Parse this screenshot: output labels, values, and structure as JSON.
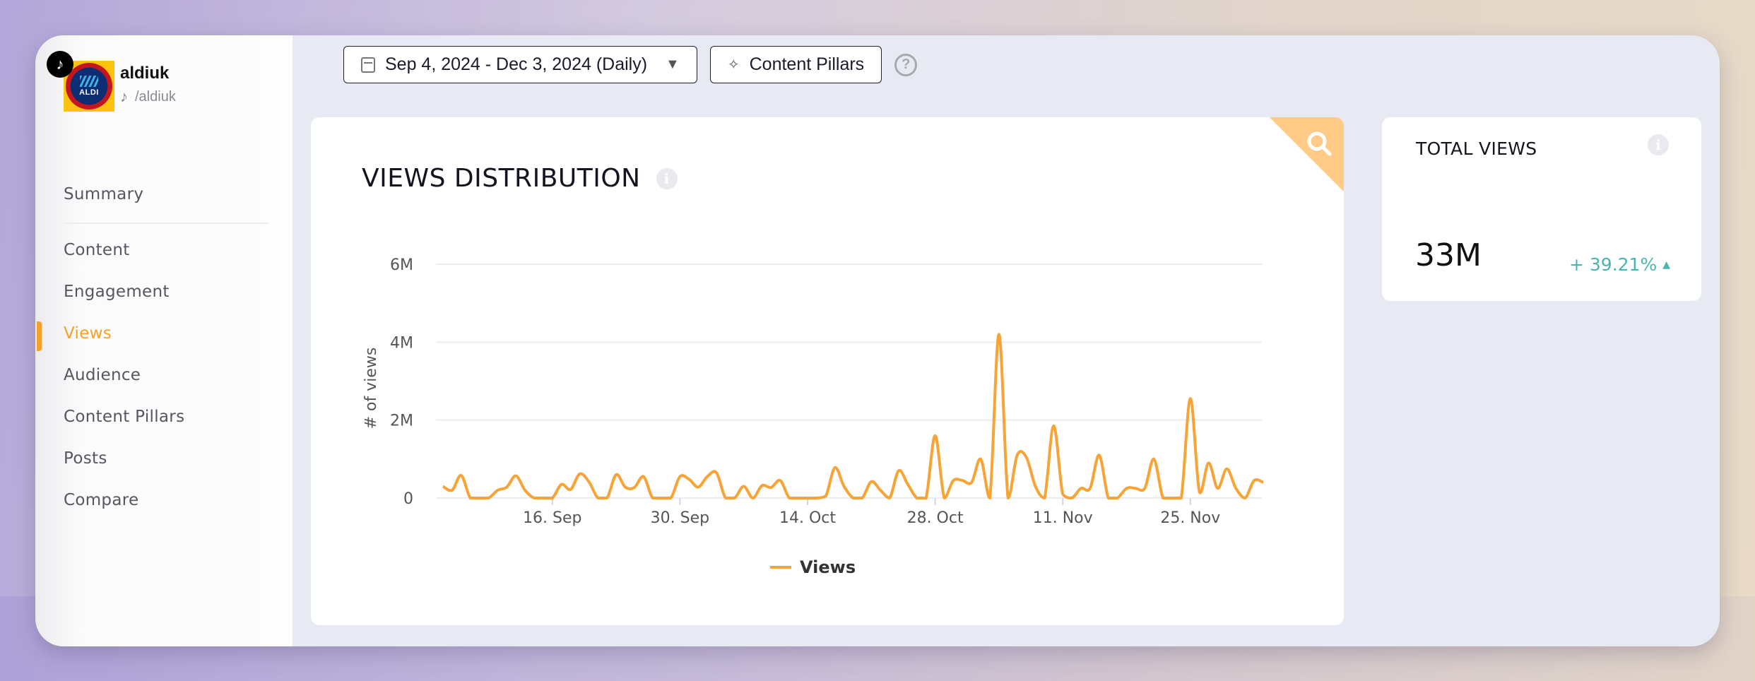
{
  "profile": {
    "name": "aldiuk",
    "handle": "/aldiuk",
    "avatar_text": "ALDI",
    "platform_icon": "tiktok-icon"
  },
  "sidebar": {
    "items": [
      {
        "label": "Summary",
        "active": false
      },
      {
        "label": "Content",
        "active": false
      },
      {
        "label": "Engagement",
        "active": false
      },
      {
        "label": "Views",
        "active": true
      },
      {
        "label": "Audience",
        "active": false
      },
      {
        "label": "Content Pillars",
        "active": false
      },
      {
        "label": "Posts",
        "active": false
      },
      {
        "label": "Compare",
        "active": false
      }
    ],
    "active_color": "#f5a02a"
  },
  "toolbar": {
    "date_range": "Sep 4, 2024 - Dec 3, 2024 (Daily)",
    "content_pillars_label": "Content Pillars",
    "help_label": "?"
  },
  "views_distribution": {
    "title": "VIEWS DISTRIBUTION",
    "info_label": "i"
  },
  "total_views": {
    "title": "TOTAL VIEWS",
    "value": "33M",
    "change": "+ 39.21%",
    "change_direction": "up",
    "change_color": "#4ab5b0",
    "info_label": "i"
  },
  "chart_data": {
    "type": "line",
    "title": "VIEWS DISTRIBUTION",
    "xlabel": "",
    "ylabel": "# of views",
    "ylim": [
      0,
      6000000
    ],
    "yticks": [
      0,
      2000000,
      4000000,
      6000000
    ],
    "ytick_labels": [
      "0",
      "2M",
      "4M",
      "6M"
    ],
    "xtick_labels": [
      "16. Sep",
      "30. Sep",
      "14. Oct",
      "28. Oct",
      "11. Nov",
      "25. Nov"
    ],
    "xtick_day_index": [
      12,
      26,
      40,
      54,
      68,
      82
    ],
    "start_date": "2024-09-04",
    "end_date": "2024-12-03",
    "grid": true,
    "legend": "bottom-center",
    "series": [
      {
        "name": "Views",
        "color": "#f7a335",
        "unit": "millions",
        "values": [
          0.3,
          0.2,
          0.58,
          0,
          0,
          0,
          0.2,
          0.28,
          0.57,
          0.2,
          0,
          0,
          0,
          0.35,
          0.22,
          0.62,
          0.42,
          0,
          0,
          0.6,
          0.28,
          0.27,
          0.55,
          0,
          0,
          0,
          0.55,
          0.48,
          0.28,
          0.55,
          0.65,
          0,
          0,
          0.3,
          0,
          0.32,
          0.27,
          0.45,
          0,
          0,
          0,
          0,
          0.05,
          0.78,
          0.3,
          0,
          0,
          0.42,
          0.2,
          0,
          0.7,
          0.35,
          0,
          0,
          1.6,
          0,
          0.45,
          0.45,
          0.4,
          1.0,
          0,
          4.2,
          0,
          1.1,
          1.05,
          0.3,
          0,
          1.85,
          0.1,
          0,
          0.25,
          0.25,
          1.1,
          0,
          0,
          0.25,
          0.25,
          0.25,
          1.0,
          0,
          0,
          0,
          2.55,
          0.15,
          0.9,
          0.25,
          0.75,
          0.25,
          0,
          0.45,
          0.4
        ]
      }
    ]
  }
}
